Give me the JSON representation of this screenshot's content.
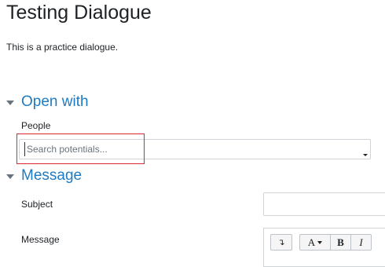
{
  "page": {
    "title": "Testing Dialogue",
    "intro": "This is a practice dialogue."
  },
  "open_with": {
    "section_title": "Open with",
    "people_label": "People",
    "search_placeholder": "Search potentials..."
  },
  "message_section": {
    "section_title": "Message",
    "subject_label": "Subject",
    "subject_value": "",
    "message_label": "Message",
    "toolbar": {
      "expand_glyph": "↴",
      "font_glyph": "A",
      "bold_glyph": "B",
      "italic_glyph": "I"
    }
  },
  "colors": {
    "section_title": "#1f7bc1",
    "highlight_border": "#d9262f",
    "text": "#1d2125"
  },
  "icons": {
    "section_toggle": "caret-down-icon",
    "dropdown": "dropdown-arrow-icon"
  }
}
